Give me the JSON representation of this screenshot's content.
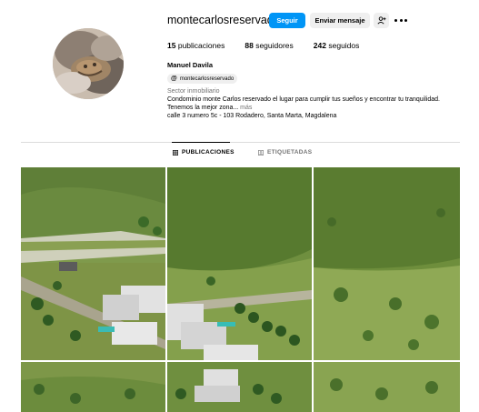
{
  "profile": {
    "username": "montecarlosreservado",
    "follow_label": "Seguir",
    "message_label": "Enviar mensaje",
    "suggest_icon": "person-add-icon",
    "more_icon": "more-icon",
    "stats": {
      "posts_count": "15",
      "posts_label": "publicaciones",
      "followers_count": "88",
      "followers_label": "seguidores",
      "following_count": "242",
      "following_label": "seguidos"
    },
    "full_name": "Manuel Davila",
    "threads_handle": "montecarlosreservado",
    "category": "Sector inmobiliario",
    "bio_line1": "Condominio monte Carlos reservado el lugar para cumplir tus sueños y encontrar tu tranquilidad.",
    "bio_line2": "Tenemos la mejor zona...",
    "bio_more": "más",
    "address": "calle 3 numero 5c - 103 Rodadero, Santa Marta, Magdalena"
  },
  "tabs": [
    {
      "label": "PUBLICACIONES",
      "icon": "grid-icon",
      "active": true
    },
    {
      "label": "ETIQUETADAS",
      "icon": "tagged-icon",
      "active": false
    }
  ],
  "colors": {
    "accent": "#0095f6",
    "secondary_button": "#efefef",
    "muted_text": "#737373",
    "divider": "#dbdbdb"
  }
}
